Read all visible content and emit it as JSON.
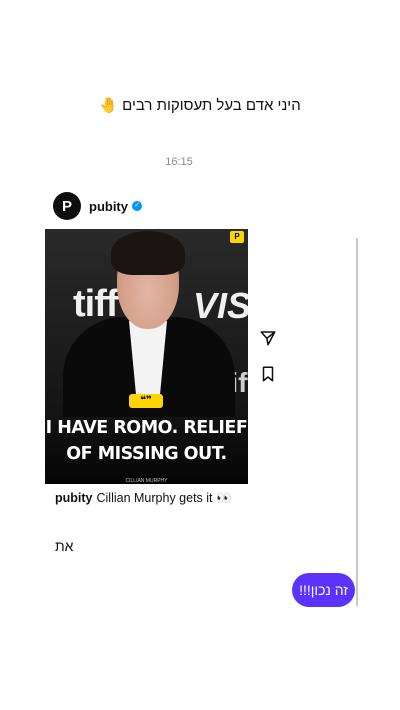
{
  "profile": {
    "bio": "היני אדם בעל תעסוקות רבים 🤚"
  },
  "thread": {
    "timestamp": "16:15"
  },
  "post": {
    "username": "pubity",
    "verified_icon": "verified-badge-icon",
    "avatar_letter": "P",
    "image": {
      "logo_left": "tiff",
      "logo_right": "VISA",
      "logo_lower": "tiff",
      "quote_badge": "❝❞",
      "headline_line1": "I HAVE ROMO. RELIEF",
      "headline_line2": "OF MISSING OUT.",
      "credit": "CILLIAN MURPHY",
      "corner_badge": "P"
    },
    "caption_user": "pubity",
    "caption_text": "Cillian Murphy gets it 👀",
    "icons": [
      "share-icon",
      "bookmark-icon"
    ]
  },
  "messages": {
    "reply_text": "את",
    "sent_bubble": "זה נכון!!!"
  },
  "colors": {
    "accent": "#5b32ff",
    "verified": "#0095f6",
    "badge_yellow": "#ffd400"
  }
}
